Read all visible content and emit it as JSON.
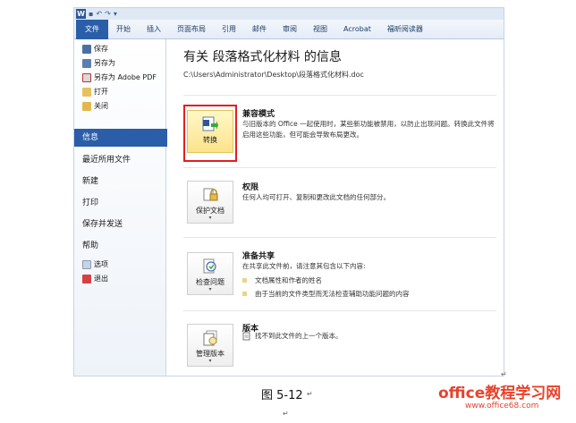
{
  "qat": {
    "logo": "W",
    "save": "▪",
    "undo": "↶",
    "redo": "↷",
    "more": "▾"
  },
  "ribbon": {
    "tabs": [
      "文件",
      "开始",
      "插入",
      "页面布局",
      "引用",
      "邮件",
      "审阅",
      "视图",
      "Acrobat",
      "福昕阅读器"
    ]
  },
  "sidebar": {
    "small_items": [
      {
        "label": "保存",
        "icon": "save-icon"
      },
      {
        "label": "另存为",
        "icon": "save-as-icon"
      },
      {
        "label": "另存为 Adobe PDF",
        "icon": "pdf-icon"
      },
      {
        "label": "打开",
        "icon": "open-folder-icon"
      },
      {
        "label": "关闭",
        "icon": "close-folder-icon"
      }
    ],
    "major_items": [
      "信息",
      "最近所用文件",
      "新建",
      "打印",
      "保存并发送",
      "帮助"
    ],
    "bottom_items": [
      {
        "label": "选项",
        "icon": "options-icon"
      },
      {
        "label": "退出",
        "icon": "exit-icon"
      }
    ]
  },
  "info": {
    "title": "有关 段落格式化材料 的信息",
    "path": "C:\\Users\\Administrator\\Desktop\\段落格式化材料.doc"
  },
  "sections": {
    "compat": {
      "button": "转换",
      "heading": "兼容模式",
      "text": "与旧版本的 Office 一起使用时，某些新功能被禁用，以防止出现问题。转换此文件将启用这些功能，但可能会导致布局更改。"
    },
    "permissions": {
      "button": "保护文档",
      "heading": "权限",
      "text": "任何人均可打开、复制和更改此文档的任何部分。"
    },
    "prepare": {
      "button": "检查问题",
      "heading": "准备共享",
      "text": "在共享此文件前，请注意其包含以下内容:",
      "bullets": [
        "文档属性和作者的姓名",
        "由于当前的文件类型而无法检查辅助功能问题的内容"
      ]
    },
    "versions": {
      "button": "管理版本",
      "heading": "版本",
      "text": "找不到此文件的上一个版本。"
    }
  },
  "caption": "图 5-12",
  "watermark": {
    "line1": "office教程学习网",
    "line2": "www.office68.com"
  },
  "colors": {
    "accent": "#2a5ea8",
    "highlight": "#fbe38a",
    "frame": "#e02020"
  }
}
